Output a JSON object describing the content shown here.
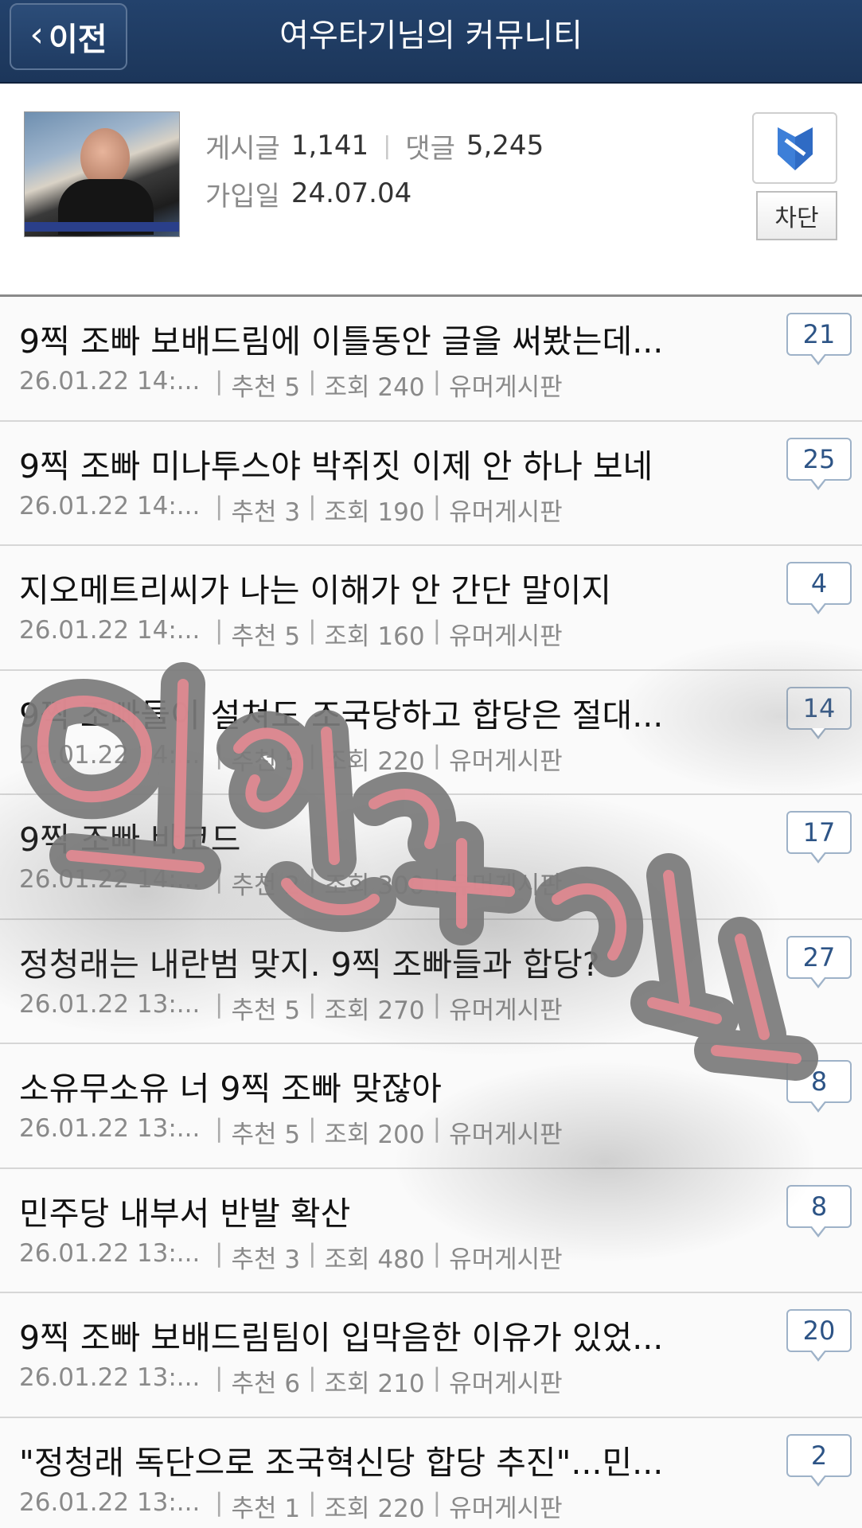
{
  "header": {
    "back_label": "이전",
    "title": "여우타기님의 커뮤니티"
  },
  "profile": {
    "posts_label": "게시글",
    "posts_count": "1,141",
    "comments_label": "댓글",
    "comments_count": "5,245",
    "joined_label": "가입일",
    "joined_date": "24.07.04",
    "block_label": "차단"
  },
  "posts": [
    {
      "title": "9찍 조빠 보배드림에 이틀동안 글을 써봤는데...",
      "date": "26.01.22  14:...",
      "likes": "추천 5",
      "views": "조회 240",
      "board": "유머게시판",
      "comments": "21"
    },
    {
      "title": "9찍 조빠 미나투스야 박쥐짓 이제 안 하나 보네",
      "date": "26.01.22  14:...",
      "likes": "추천 3",
      "views": "조회 190",
      "board": "유머게시판",
      "comments": "25"
    },
    {
      "title": "지오메트리씨가 나는 이해가 안 간단 말이지",
      "date": "26.01.22  14:...",
      "likes": "추천 5",
      "views": "조회 160",
      "board": "유머게시판",
      "comments": "4"
    },
    {
      "title": "9찍 조빠들이 설쳐도 조국당하고 합당은 절대...",
      "date": "26.01.22  14:...",
      "likes": "추천 5",
      "views": "조회 220",
      "board": "유머게시판",
      "comments": "14"
    },
    {
      "title": "9찍 조빠 바코드",
      "date": "26.01.22  14:...",
      "likes": "추천 2",
      "views": "조회 300",
      "board": "유머게시판",
      "comments": "17"
    },
    {
      "title": "정청래는 내란범 맞지. 9찍 조빠들과 합당?",
      "date": "26.01.22  13:...",
      "likes": "추천 5",
      "views": "조회 270",
      "board": "유머게시판",
      "comments": "27"
    },
    {
      "title": "소유무소유 너 9찍 조빠 맞잖아",
      "date": "26.01.22  13:...",
      "likes": "추천 5",
      "views": "조회 200",
      "board": "유머게시판",
      "comments": "8"
    },
    {
      "title": "민주당 내부서 반발 확산",
      "date": "26.01.22  13:...",
      "likes": "추천 3",
      "views": "조회 480",
      "board": "유머게시판",
      "comments": "8"
    },
    {
      "title": "9찍 조빠 보배드림팀이 입막음한 이유가 있었...",
      "date": "26.01.22  13:...",
      "likes": "추천 6",
      "views": "조회 210",
      "board": "유머게시판",
      "comments": "20"
    },
    {
      "title": "\"정청래 독단으로 조국혁신당 합당 추진\"...민...",
      "date": "26.01.22  13:...",
      "likes": "추천 1",
      "views": "조회 220",
      "board": "유머게시판",
      "comments": "2"
    }
  ]
}
